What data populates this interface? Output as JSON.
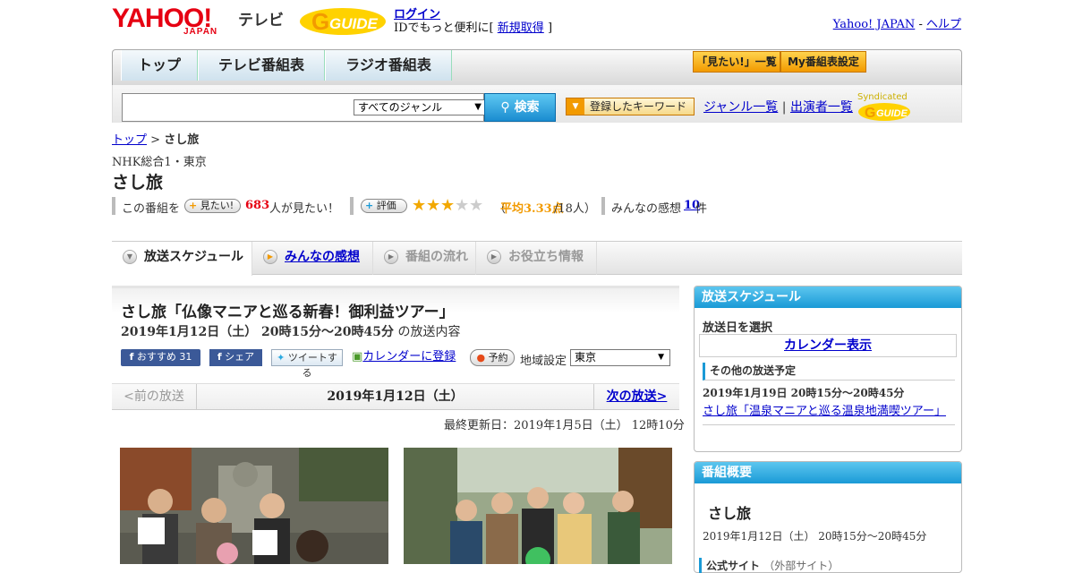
{
  "header": {
    "logo_text": "YAHOO!",
    "logo_sub": "JAPAN",
    "service_label": "テレビ",
    "gguide_label": "GUIDE",
    "login_link": "ログイン",
    "login_prompt": "IDでもっと便利に[",
    "register_link": "新規取得",
    "login_close": "]",
    "yahoo_japan_link": "Yahoo! JAPAN",
    "separator": "-",
    "help_link": "ヘルプ"
  },
  "nav": {
    "tabs": [
      {
        "label": "トップ"
      },
      {
        "label": "テレビ番組表"
      },
      {
        "label": "ラジオ番組表"
      }
    ],
    "mitai_list": "「見たい!」一覧",
    "my_guide": "My番組表設定"
  },
  "search": {
    "genre_selected": "すべてのジャンル",
    "button_label": "検索",
    "keyword_button": "登録したキーワード",
    "genre_list_link": "ジャンル一覧",
    "sep": "|",
    "performer_list_link": "出演者一覧",
    "syndicated": "Syndicated"
  },
  "breadcrumb": {
    "top": "トップ",
    "sep": ">",
    "current": "さし旅"
  },
  "program": {
    "channel": "NHK総合1・東京",
    "title": "さし旅",
    "want_prefix": "この番組を",
    "want_button": "見たい!",
    "want_count": "683",
    "want_suffix": "人が見たい！",
    "rating_button": "評価",
    "rating_value": 3,
    "rating_max": 5,
    "rating_open": "（",
    "rating_avg": "平均3.33点",
    "rating_count": "/18人）",
    "reviews_label": "みんなの感想",
    "reviews_count": "10",
    "reviews_suffix": "件"
  },
  "content_tabs": [
    {
      "label": "放送スケジュール"
    },
    {
      "label": "みんなの感想"
    },
    {
      "label": "番組の流れ"
    },
    {
      "label": "お役立ち情報"
    }
  ],
  "episode": {
    "title": "さし旅「仏像マニアと巡る新春！御利益ツアー」",
    "date": "2019年1月12日（土）  20時15分～20時45分",
    "date_suffix": "の放送内容",
    "recommend": "おすすめ",
    "recommend_count": "31",
    "share": "シェア",
    "tweet": "ツイートする",
    "calendar": "カレンダーに登録",
    "reserve": "予約",
    "region_label": "地域設定",
    "region_value": "東京"
  },
  "episode_nav": {
    "prev": "<前の放送",
    "current": "2019年1月12日（土）",
    "next": "次の放送>",
    "updated": "最終更新日：2019年1月5日（土）  12時10分"
  },
  "sidebar": {
    "schedule_title": "放送スケジュール",
    "select_date": "放送日を選択",
    "calendar_link": "カレンダー表示",
    "other_title": "その他の放送予定",
    "other_date": "2019年1月19日  20時15分～20時45分",
    "other_link": "さし旅「温泉マニアと巡る温泉地満喫ツアー」",
    "summary_title": "番組概要",
    "summary_program": "さし旅",
    "summary_date": "2019年1月12日（土）  20時15分～20時45分",
    "official_site": "公式サイト",
    "official_note": "（外部サイト）"
  },
  "colors": {
    "accent": "#1a9ad6",
    "brand": "#e60012",
    "star": "#f2a800",
    "link": "#0000cc"
  }
}
